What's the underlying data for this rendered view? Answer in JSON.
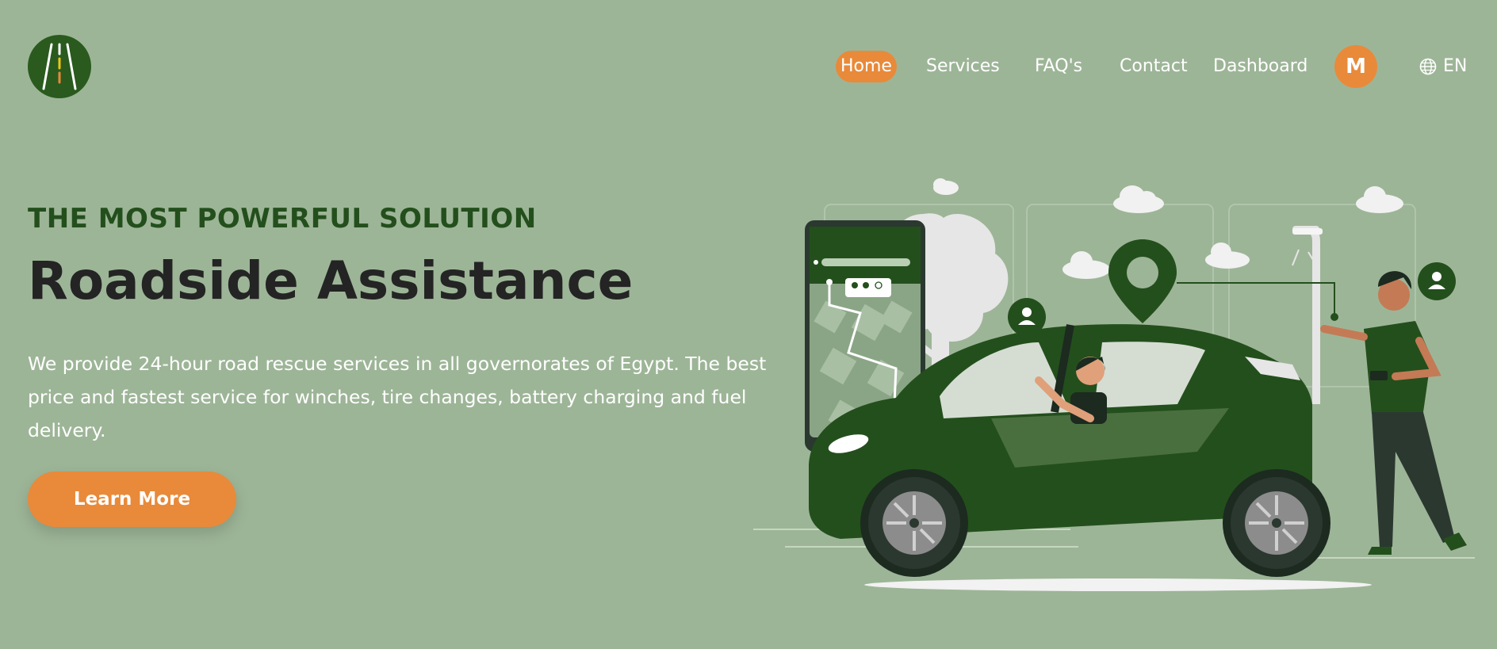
{
  "logo": {
    "icon": "road-icon"
  },
  "nav": {
    "items": [
      {
        "label": "Home",
        "active": true
      },
      {
        "label": "Services"
      },
      {
        "label": "FAQ's"
      },
      {
        "label": "Contact"
      },
      {
        "label": "Dashboard"
      }
    ],
    "avatar_initial": "M",
    "language": "EN",
    "language_icon": "globe-icon"
  },
  "hero": {
    "eyebrow": "THE MOST POWERFUL SOLUTION",
    "title": "Roadside Assistance",
    "description": "We provide 24-hour road rescue services in all governorates of Egypt. The best price and fastest service for winches, tire changes, battery charging and fuel delivery.",
    "cta_label": "Learn More"
  },
  "colors": {
    "background": "#9db597",
    "brand_dark_green": "#2a5a1e",
    "accent_orange": "#e88a3a",
    "text_dark": "#242424",
    "eyebrow_green": "#234f1c"
  }
}
